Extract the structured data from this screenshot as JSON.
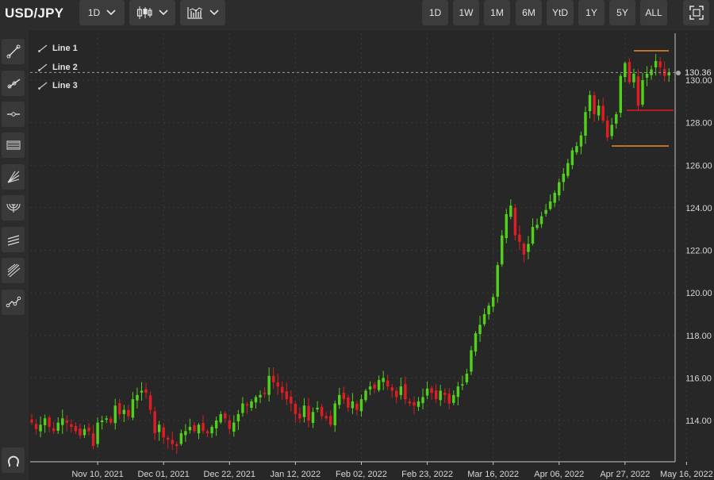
{
  "header": {
    "symbol": "USD/JPY",
    "interval": "1D",
    "chart_style_icon": "candlestick-icon",
    "indicators_icon": "indicator-chart-icon",
    "ranges": [
      "1D",
      "1W",
      "1M",
      "6M",
      "YtD",
      "1Y",
      "5Y",
      "ALL"
    ],
    "fullscreen_icon": "fullscreen-icon"
  },
  "toolbar": {
    "tools": [
      {
        "icon": "trend-line-icon"
      },
      {
        "icon": "ray-line-icon"
      },
      {
        "icon": "horizontal-line-icon"
      },
      {
        "icon": "channel-icon"
      },
      {
        "icon": "fan-icon"
      },
      {
        "icon": "arc-icon"
      },
      {
        "icon": "parallel-lines-icon"
      },
      {
        "icon": "pitchfork-icon"
      },
      {
        "icon": "polyline-icon"
      }
    ],
    "bottom_icon": "magnet-icon"
  },
  "legend": [
    "Line 1",
    "Line 2",
    "Line 3"
  ],
  "current_price": "130.36",
  "colors": {
    "background": "#262726",
    "up": "#52d11c",
    "down": "#e01c24",
    "orange_line": "#f08c1e",
    "red_line": "#e11c22",
    "grid": "#3a3b3a",
    "text": "#d7d8d6"
  },
  "chart_data": {
    "type": "candlestick",
    "title": "USD/JPY",
    "ylim": [
      112.7,
      131.5
    ],
    "y_ticks": [
      114,
      116,
      118,
      120,
      122,
      124,
      126,
      128,
      130
    ],
    "y_tick_labels": [
      "114.00",
      "116.00",
      "118.00",
      "120.00",
      "122.00",
      "124.00",
      "126.00",
      "128.00",
      "130.00"
    ],
    "x_tick_labels": [
      "Nov 10, 2021",
      "Dec 01, 2021",
      "Dec 22, 2021",
      "Jan 12, 2022",
      "Feb 02, 2022",
      "Feb 23, 2022",
      "Mar 16, 2022",
      "Apr 06, 2022",
      "Apr 27, 2022",
      "May 16, 2022"
    ],
    "x_tick_index": [
      15,
      30,
      45,
      60,
      75,
      90,
      105,
      120,
      135,
      149
    ],
    "grid": true,
    "closes": [
      113.9,
      113.6,
      113.8,
      114.1,
      113.7,
      113.5,
      113.9,
      114.1,
      113.9,
      113.7,
      113.5,
      113.3,
      113.6,
      113.5,
      112.8,
      113.9,
      114.0,
      114.1,
      113.9,
      114.7,
      114.3,
      114.5,
      114.2,
      115.0,
      115.2,
      115.4,
      115.3,
      114.5,
      113.4,
      113.8,
      113.2,
      113.1,
      112.9,
      112.8,
      113.4,
      113.5,
      113.7,
      113.5,
      113.8,
      113.5,
      113.4,
      113.7,
      114.0,
      114.3,
      114.1,
      113.6,
      113.9,
      114.3,
      114.8,
      114.7,
      114.9,
      115.1,
      115.2,
      115.3,
      116.1,
      115.8,
      115.6,
      115.3,
      115.0,
      114.8,
      114.3,
      114.1,
      114.7,
      114.0,
      114.4,
      114.6,
      114.2,
      114.1,
      113.8,
      114.8,
      115.2,
      115.0,
      114.6,
      114.9,
      114.5,
      115.0,
      115.4,
      115.6,
      115.5,
      115.9,
      116.0,
      115.6,
      115.4,
      115.1,
      115.6,
      115.0,
      114.8,
      114.7,
      114.9,
      115.1,
      115.5,
      115.3,
      115.0,
      115.4,
      115.2,
      114.8,
      115.2,
      115.6,
      115.7,
      116.2,
      117.3,
      118.1,
      118.5,
      119.0,
      119.4,
      119.8,
      121.3,
      122.7,
      123.7,
      124.1,
      122.7,
      122.4,
      121.8,
      122.3,
      123.1,
      123.2,
      123.6,
      123.9,
      124.3,
      124.7,
      125.2,
      125.6,
      126.1,
      126.7,
      126.9,
      127.4,
      128.5,
      129.3,
      128.4,
      128.8,
      128.1,
      127.3,
      127.9,
      128.4,
      130.2,
      130.8,
      129.9,
      130.3,
      128.8,
      130.0,
      130.3,
      130.5,
      130.9,
      130.6,
      130.2,
      130.36
    ]
  }
}
